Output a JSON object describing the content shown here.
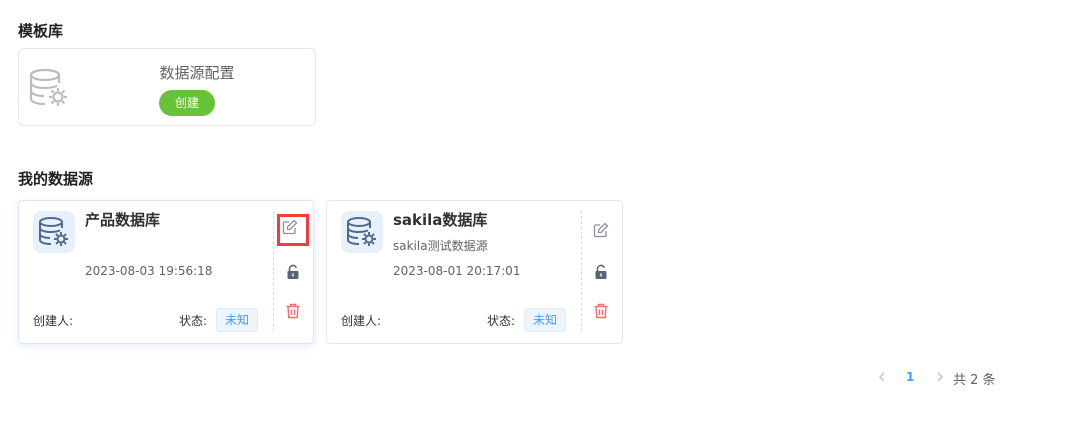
{
  "template_section": {
    "title": "模板库",
    "template": {
      "name": "数据源配置",
      "create_label": "创建",
      "icon": "database-gear-icon"
    }
  },
  "my_section": {
    "title": "我的数据源",
    "datasources": [
      {
        "name": "产品数据库",
        "description": "",
        "time": "2023-08-03 19:56:18",
        "creator_label": "创建人:",
        "status_label": "状态:",
        "status": "未知"
      },
      {
        "name": "sakila数据库",
        "description": "sakila测试数据源",
        "time": "2023-08-01 20:17:01",
        "creator_label": "创建人:",
        "status_label": "状态:",
        "status": "未知"
      }
    ]
  },
  "pagination": {
    "current": "1",
    "total_text": "共 2 条"
  },
  "colors": {
    "accent": "#409eff",
    "success": "#67c23a",
    "danger": "#f56c6c",
    "highlight": "#f03c3c"
  }
}
